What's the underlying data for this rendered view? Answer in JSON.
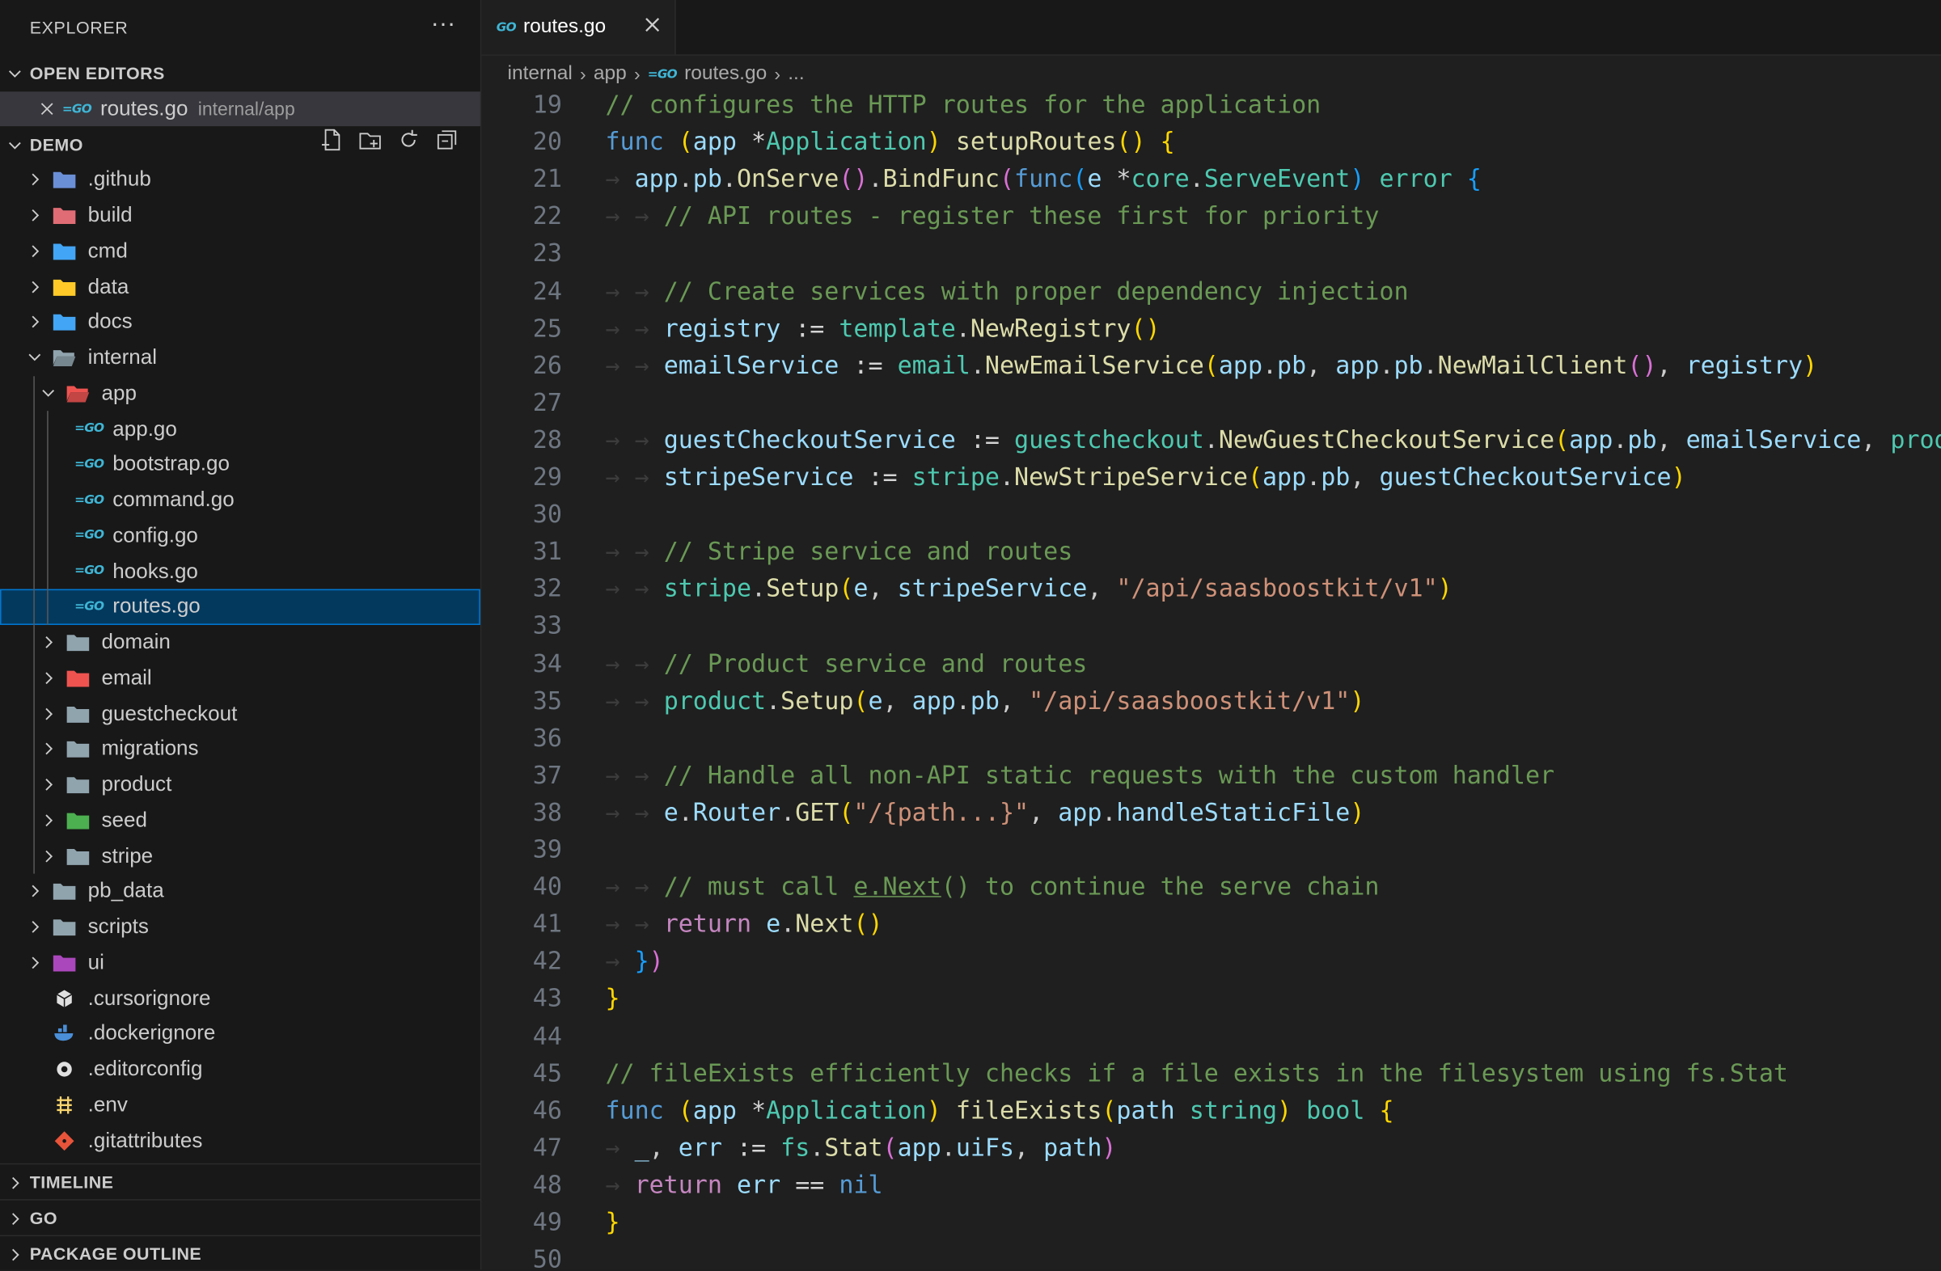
{
  "sidebar": {
    "title": "EXPLORER",
    "more": "···",
    "open_editors_title": "OPEN EDITORS",
    "open_editor": {
      "name": "routes.go",
      "path": "internal/app"
    },
    "project_title": "DEMO",
    "tree": [
      {
        "label": ".github",
        "kind": "folder",
        "icon": "github-folder-icon",
        "color": "#6b8fd6",
        "depth": 0,
        "expanded": false
      },
      {
        "label": "build",
        "kind": "folder",
        "icon": "build-folder-icon",
        "color": "#e06c75",
        "depth": 0,
        "expanded": false
      },
      {
        "label": "cmd",
        "kind": "folder",
        "icon": "cmd-folder-icon",
        "color": "#42a5f5",
        "depth": 0,
        "expanded": false
      },
      {
        "label": "data",
        "kind": "folder",
        "icon": "data-folder-icon",
        "color": "#ffca28",
        "depth": 0,
        "expanded": false
      },
      {
        "label": "docs",
        "kind": "folder",
        "icon": "docs-folder-icon",
        "color": "#42a5f5",
        "depth": 0,
        "expanded": false
      },
      {
        "label": "internal",
        "kind": "folder",
        "icon": "folder-open-icon",
        "color": "#90a4ae",
        "depth": 0,
        "expanded": true
      },
      {
        "label": "app",
        "kind": "folder",
        "icon": "app-folder-icon",
        "color": "#ef5350",
        "depth": 1,
        "expanded": true
      },
      {
        "label": "app.go",
        "kind": "go",
        "depth": 2
      },
      {
        "label": "bootstrap.go",
        "kind": "go",
        "depth": 2
      },
      {
        "label": "command.go",
        "kind": "go",
        "depth": 2
      },
      {
        "label": "config.go",
        "kind": "go",
        "depth": 2
      },
      {
        "label": "hooks.go",
        "kind": "go",
        "depth": 2
      },
      {
        "label": "routes.go",
        "kind": "go",
        "depth": 2,
        "selected": true
      },
      {
        "label": "domain",
        "kind": "folder",
        "icon": "folder-icon",
        "color": "#90a4ae",
        "depth": 1,
        "expanded": false
      },
      {
        "label": "email",
        "kind": "folder",
        "icon": "email-folder-icon",
        "color": "#ef5350",
        "depth": 1,
        "expanded": false
      },
      {
        "label": "guestcheckout",
        "kind": "folder",
        "icon": "folder-icon",
        "color": "#90a4ae",
        "depth": 1,
        "expanded": false
      },
      {
        "label": "migrations",
        "kind": "folder",
        "icon": "folder-icon",
        "color": "#90a4ae",
        "depth": 1,
        "expanded": false
      },
      {
        "label": "product",
        "kind": "folder",
        "icon": "folder-icon",
        "color": "#90a4ae",
        "depth": 1,
        "expanded": false
      },
      {
        "label": "seed",
        "kind": "folder",
        "icon": "seed-folder-icon",
        "color": "#4caf50",
        "depth": 1,
        "expanded": false
      },
      {
        "label": "stripe",
        "kind": "folder",
        "icon": "folder-icon",
        "color": "#90a4ae",
        "depth": 1,
        "expanded": false
      },
      {
        "label": "pb_data",
        "kind": "folder",
        "icon": "folder-icon",
        "color": "#90a4ae",
        "depth": 0,
        "expanded": false
      },
      {
        "label": "scripts",
        "kind": "folder",
        "icon": "scripts-folder-icon",
        "color": "#90a4ae",
        "depth": 0,
        "expanded": false
      },
      {
        "label": "ui",
        "kind": "folder",
        "icon": "ui-folder-icon",
        "color": "#ab47bc",
        "depth": 0,
        "expanded": false
      },
      {
        "label": ".cursorignore",
        "kind": "file",
        "icon": "cursor-icon",
        "color": "#e0e0e0",
        "depth": 0
      },
      {
        "label": ".dockerignore",
        "kind": "file",
        "icon": "docker-icon",
        "color": "#4a8fd8",
        "depth": 0
      },
      {
        "label": ".editorconfig",
        "kind": "file",
        "icon": "editorconfig-icon",
        "color": "#e0e0e0",
        "depth": 0
      },
      {
        "label": ".env",
        "kind": "file",
        "icon": "env-icon",
        "color": "#f9d56e",
        "depth": 0
      },
      {
        "label": ".gitattributes",
        "kind": "file",
        "icon": "git-icon",
        "color": "#e8543a",
        "depth": 0
      }
    ],
    "timeline_title": "TIMELINE",
    "go_title": "GO",
    "package_outline_title": "PACKAGE OUTLINE"
  },
  "tab": {
    "label": "routes.go",
    "badge": "GO"
  },
  "breadcrumb": {
    "parts": [
      "internal",
      "app",
      "routes.go",
      "..."
    ]
  },
  "editor": {
    "lines": [
      {
        "n": 19,
        "indent": 0,
        "tokens": [
          [
            "com",
            "// configures the HTTP routes for the application"
          ]
        ]
      },
      {
        "n": 20,
        "indent": 0,
        "tokens": [
          [
            "kw",
            "func"
          ],
          [
            "op",
            " "
          ],
          [
            "b1",
            "("
          ],
          [
            "var",
            "app"
          ],
          [
            "op",
            " *"
          ],
          [
            "type",
            "Application"
          ],
          [
            "b1",
            ")"
          ],
          [
            "op",
            " "
          ],
          [
            "fn",
            "setupRoutes"
          ],
          [
            "b1",
            "()"
          ],
          [
            "op",
            " "
          ],
          [
            "b1",
            "{"
          ]
        ]
      },
      {
        "n": 21,
        "indent": 1,
        "tokens": [
          [
            "var",
            "app"
          ],
          [
            "punc",
            "."
          ],
          [
            "var",
            "pb"
          ],
          [
            "punc",
            "."
          ],
          [
            "fn",
            "OnServe"
          ],
          [
            "b2",
            "()"
          ],
          [
            "punc",
            "."
          ],
          [
            "fn",
            "BindFunc"
          ],
          [
            "b2",
            "("
          ],
          [
            "kw",
            "func"
          ],
          [
            "b3",
            "("
          ],
          [
            "var",
            "e"
          ],
          [
            "op",
            " *"
          ],
          [
            "type",
            "core"
          ],
          [
            "punc",
            "."
          ],
          [
            "type",
            "ServeEvent"
          ],
          [
            "b3",
            ")"
          ],
          [
            "op",
            " "
          ],
          [
            "type",
            "error"
          ],
          [
            "op",
            " "
          ],
          [
            "b3",
            "{"
          ]
        ]
      },
      {
        "n": 22,
        "indent": 2,
        "tokens": [
          [
            "com",
            "// API routes - register these first for priority"
          ]
        ]
      },
      {
        "n": 23,
        "indent": 0,
        "tokens": []
      },
      {
        "n": 24,
        "indent": 2,
        "tokens": [
          [
            "com",
            "// Create services with proper dependency injection"
          ]
        ]
      },
      {
        "n": 25,
        "indent": 2,
        "tokens": [
          [
            "var",
            "registry"
          ],
          [
            "op",
            " := "
          ],
          [
            "pkg",
            "template"
          ],
          [
            "punc",
            "."
          ],
          [
            "fn",
            "NewRegistry"
          ],
          [
            "b1",
            "()"
          ]
        ]
      },
      {
        "n": 26,
        "indent": 2,
        "tokens": [
          [
            "var",
            "emailService"
          ],
          [
            "op",
            " := "
          ],
          [
            "pkg",
            "email"
          ],
          [
            "punc",
            "."
          ],
          [
            "fn",
            "NewEmailService"
          ],
          [
            "b1",
            "("
          ],
          [
            "var",
            "app"
          ],
          [
            "punc",
            "."
          ],
          [
            "var",
            "pb"
          ],
          [
            "punc",
            ", "
          ],
          [
            "var",
            "app"
          ],
          [
            "punc",
            "."
          ],
          [
            "var",
            "pb"
          ],
          [
            "punc",
            "."
          ],
          [
            "fn",
            "NewMailClient"
          ],
          [
            "b2",
            "()"
          ],
          [
            "punc",
            ", "
          ],
          [
            "var",
            "registry"
          ],
          [
            "b1",
            ")"
          ]
        ]
      },
      {
        "n": 27,
        "indent": 0,
        "tokens": []
      },
      {
        "n": 28,
        "indent": 2,
        "tokens": [
          [
            "var",
            "guestCheckoutService"
          ],
          [
            "op",
            " := "
          ],
          [
            "pkg",
            "guestcheckout"
          ],
          [
            "punc",
            "."
          ],
          [
            "fn",
            "NewGuestCheckoutService"
          ],
          [
            "b1",
            "("
          ],
          [
            "var",
            "app"
          ],
          [
            "punc",
            "."
          ],
          [
            "var",
            "pb"
          ],
          [
            "punc",
            ", "
          ],
          [
            "var",
            "emailService"
          ],
          [
            "punc",
            ", "
          ],
          [
            "pkg",
            "prod"
          ]
        ]
      },
      {
        "n": 29,
        "indent": 2,
        "tokens": [
          [
            "var",
            "stripeService"
          ],
          [
            "op",
            " := "
          ],
          [
            "pkg",
            "stripe"
          ],
          [
            "punc",
            "."
          ],
          [
            "fn",
            "NewStripeService"
          ],
          [
            "b1",
            "("
          ],
          [
            "var",
            "app"
          ],
          [
            "punc",
            "."
          ],
          [
            "var",
            "pb"
          ],
          [
            "punc",
            ", "
          ],
          [
            "var",
            "guestCheckoutService"
          ],
          [
            "b1",
            ")"
          ]
        ]
      },
      {
        "n": 30,
        "indent": 0,
        "tokens": []
      },
      {
        "n": 31,
        "indent": 2,
        "tokens": [
          [
            "com",
            "// Stripe service and routes"
          ]
        ]
      },
      {
        "n": 32,
        "indent": 2,
        "tokens": [
          [
            "pkg",
            "stripe"
          ],
          [
            "punc",
            "."
          ],
          [
            "fn",
            "Setup"
          ],
          [
            "b1",
            "("
          ],
          [
            "var",
            "e"
          ],
          [
            "punc",
            ", "
          ],
          [
            "var",
            "stripeService"
          ],
          [
            "punc",
            ", "
          ],
          [
            "str",
            "\"/api/saasboostkit/v1\""
          ],
          [
            "b1",
            ")"
          ]
        ]
      },
      {
        "n": 33,
        "indent": 0,
        "tokens": []
      },
      {
        "n": 34,
        "indent": 2,
        "tokens": [
          [
            "com",
            "// Product service and routes"
          ]
        ]
      },
      {
        "n": 35,
        "indent": 2,
        "tokens": [
          [
            "pkg",
            "product"
          ],
          [
            "punc",
            "."
          ],
          [
            "fn",
            "Setup"
          ],
          [
            "b1",
            "("
          ],
          [
            "var",
            "e"
          ],
          [
            "punc",
            ", "
          ],
          [
            "var",
            "app"
          ],
          [
            "punc",
            "."
          ],
          [
            "var",
            "pb"
          ],
          [
            "punc",
            ", "
          ],
          [
            "str",
            "\"/api/saasboostkit/v1\""
          ],
          [
            "b1",
            ")"
          ]
        ]
      },
      {
        "n": 36,
        "indent": 0,
        "tokens": []
      },
      {
        "n": 37,
        "indent": 2,
        "tokens": [
          [
            "com",
            "// Handle all non-API static requests with the custom handler"
          ]
        ]
      },
      {
        "n": 38,
        "indent": 2,
        "tokens": [
          [
            "var",
            "e"
          ],
          [
            "punc",
            "."
          ],
          [
            "var",
            "Router"
          ],
          [
            "punc",
            "."
          ],
          [
            "fn",
            "GET"
          ],
          [
            "b1",
            "("
          ],
          [
            "str",
            "\"/{path...}\""
          ],
          [
            "punc",
            ", "
          ],
          [
            "var",
            "app"
          ],
          [
            "punc",
            "."
          ],
          [
            "var",
            "handleStaticFile"
          ],
          [
            "b1",
            ")"
          ]
        ]
      },
      {
        "n": 39,
        "indent": 0,
        "tokens": []
      },
      {
        "n": 40,
        "indent": 2,
        "tokens": [
          [
            "com",
            "// must call "
          ],
          [
            "comlink",
            "e.Next"
          ],
          [
            "com",
            "() to continue the serve chain"
          ]
        ]
      },
      {
        "n": 41,
        "indent": 2,
        "tokens": [
          [
            "ctl",
            "return"
          ],
          [
            "op",
            " "
          ],
          [
            "var",
            "e"
          ],
          [
            "punc",
            "."
          ],
          [
            "fn",
            "Next"
          ],
          [
            "b1",
            "()"
          ]
        ]
      },
      {
        "n": 42,
        "indent": 1,
        "tokens": [
          [
            "b3",
            "}"
          ],
          [
            "b2",
            ")"
          ]
        ]
      },
      {
        "n": 43,
        "indent": 0,
        "tokens": [
          [
            "b1",
            "}"
          ]
        ]
      },
      {
        "n": 44,
        "indent": 0,
        "tokens": []
      },
      {
        "n": 45,
        "indent": 0,
        "tokens": [
          [
            "com",
            "// fileExists efficiently checks if a file exists in the filesystem using fs.Stat"
          ]
        ]
      },
      {
        "n": 46,
        "indent": 0,
        "tokens": [
          [
            "kw",
            "func"
          ],
          [
            "op",
            " "
          ],
          [
            "b1",
            "("
          ],
          [
            "var",
            "app"
          ],
          [
            "op",
            " *"
          ],
          [
            "type",
            "Application"
          ],
          [
            "b1",
            ")"
          ],
          [
            "op",
            " "
          ],
          [
            "fn",
            "fileExists"
          ],
          [
            "b1",
            "("
          ],
          [
            "var",
            "path"
          ],
          [
            "op",
            " "
          ],
          [
            "type",
            "string"
          ],
          [
            "b1",
            ")"
          ],
          [
            "op",
            " "
          ],
          [
            "type",
            "bool"
          ],
          [
            "op",
            " "
          ],
          [
            "b1",
            "{"
          ]
        ]
      },
      {
        "n": 47,
        "indent": 1,
        "tokens": [
          [
            "var",
            "_"
          ],
          [
            "punc",
            ", "
          ],
          [
            "var",
            "err"
          ],
          [
            "op",
            " := "
          ],
          [
            "pkg",
            "fs"
          ],
          [
            "punc",
            "."
          ],
          [
            "fn",
            "Stat"
          ],
          [
            "b2",
            "("
          ],
          [
            "var",
            "app"
          ],
          [
            "punc",
            "."
          ],
          [
            "var",
            "uiFs"
          ],
          [
            "punc",
            ", "
          ],
          [
            "var",
            "path"
          ],
          [
            "b2",
            ")"
          ]
        ]
      },
      {
        "n": 48,
        "indent": 1,
        "tokens": [
          [
            "ctl",
            "return"
          ],
          [
            "op",
            " "
          ],
          [
            "var",
            "err"
          ],
          [
            "op",
            " == "
          ],
          [
            "kw",
            "nil"
          ]
        ]
      },
      {
        "n": 49,
        "indent": 0,
        "tokens": [
          [
            "b1",
            "}"
          ]
        ]
      },
      {
        "n": 50,
        "indent": 0,
        "tokens": []
      }
    ]
  }
}
